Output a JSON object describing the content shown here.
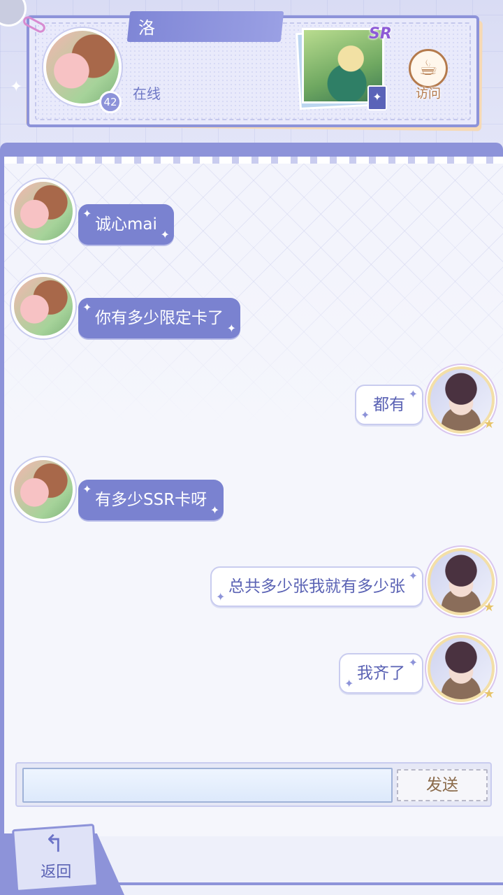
{
  "profile": {
    "name": "洛",
    "status": "在线",
    "level": "42",
    "card_rarity": "SR",
    "visit_label": "访问"
  },
  "messages": [
    {
      "side": "left",
      "text": "诚心mai"
    },
    {
      "side": "left",
      "text": "你有多少限定卡了"
    },
    {
      "side": "right",
      "text": "都有"
    },
    {
      "side": "left",
      "text": "有多少SSR卡呀"
    },
    {
      "side": "right",
      "text": "总共多少张我就有多少张"
    },
    {
      "side": "right",
      "text": "我齐了"
    }
  ],
  "composer": {
    "input_value": "",
    "send_label": "发送"
  },
  "nav": {
    "back_label": "返回"
  },
  "icons": {
    "visit": "coffee-cup-icon",
    "back": "return-arrow-icon",
    "clip": "paperclip-icon",
    "sparkle": "sparkle-icon"
  },
  "colors": {
    "accent": "#8d93d9",
    "bubble_left": "#7a82d0",
    "bubble_right_text": "#5a62b4",
    "visit": "#b47a4c"
  }
}
